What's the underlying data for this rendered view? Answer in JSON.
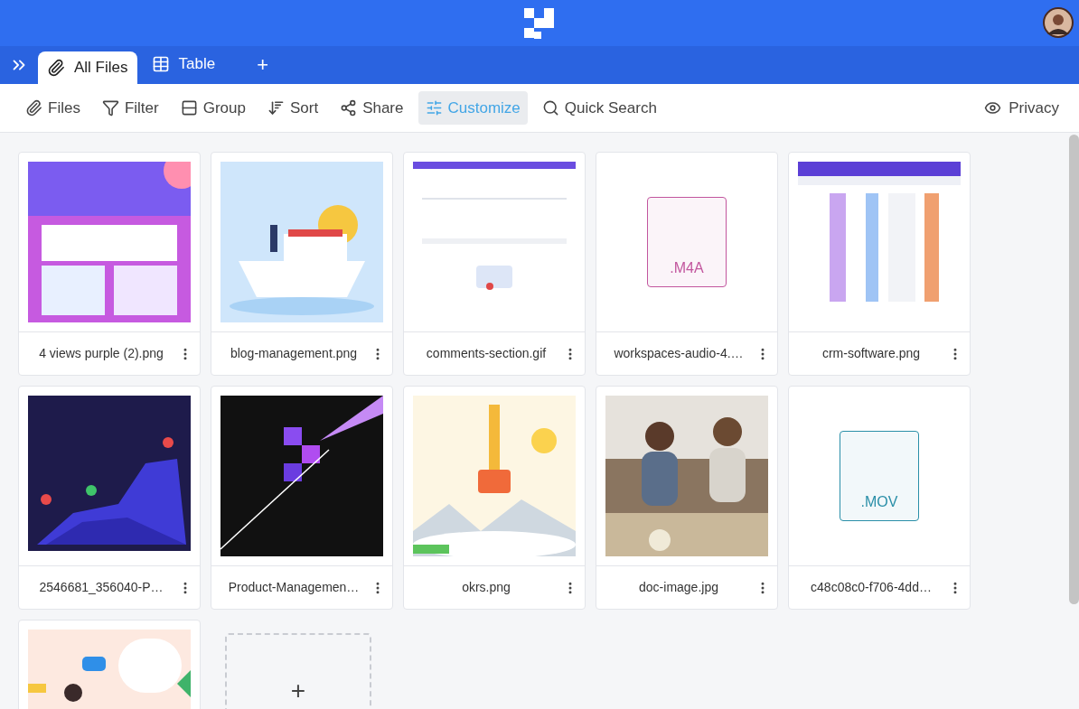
{
  "tabs": [
    {
      "label": "All Files",
      "selected": true
    },
    {
      "label": "Table",
      "selected": false
    }
  ],
  "add_tab": "+",
  "toolbar": [
    {
      "label": "Files",
      "selected": false
    },
    {
      "label": "Filter",
      "selected": false
    },
    {
      "label": "Group",
      "selected": false
    },
    {
      "label": "Sort",
      "selected": false
    },
    {
      "label": "Share",
      "selected": false
    },
    {
      "label": "Customize",
      "selected": true
    },
    {
      "label": "Quick Search",
      "selected": false
    }
  ],
  "privacy": "Privacy",
  "files": [
    {
      "kind": "picture",
      "name": "4 views purple (2).png"
    },
    {
      "kind": "picture",
      "name": "blog-management.png"
    },
    {
      "kind": "picture",
      "name": "comments-section.gif"
    },
    {
      "kind": "file",
      "name": "workspaces-audio-4.…",
      "extension": ".M4A",
      "color": "#c2569e"
    },
    {
      "kind": "picture",
      "name": "crm-software.png"
    },
    {
      "kind": "picture",
      "name": "2546681_356040-P…"
    },
    {
      "kind": "picture",
      "name": "Product-Managemen…"
    },
    {
      "kind": "picture",
      "name": "okrs.png"
    },
    {
      "kind": "picture",
      "name": "doc-image.jpg"
    },
    {
      "kind": "file",
      "name": "c48c08c0-f706-4dd…",
      "extension": ".MOV",
      "color": "#2a8fa8"
    },
    {
      "kind": "picture"
    }
  ],
  "add_card": "+"
}
